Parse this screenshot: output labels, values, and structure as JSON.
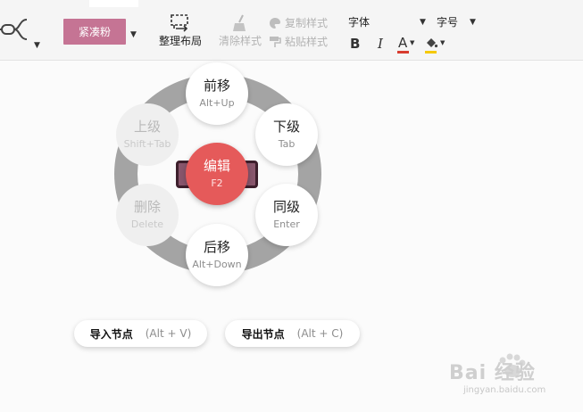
{
  "toolbar": {
    "theme_label": "紧凑粉",
    "layout_label": "整理布局",
    "clear_style_label": "清除样式",
    "copy_style_label": "复制样式",
    "paste_style_label": "粘贴样式",
    "font_label": "字体",
    "font_size_label": "字号",
    "bold_label": "B",
    "italic_label": "I",
    "font_color_label": "A",
    "colors": {
      "theme": "#c57494",
      "font_color_bar": "#d83b2f",
      "bg_color_bar": "#f5c900"
    }
  },
  "hotbox": {
    "center": {
      "label": "编辑",
      "key": "F2"
    },
    "up": {
      "label": "前移",
      "key": "Alt+Up"
    },
    "down": {
      "label": "后移",
      "key": "Alt+Down"
    },
    "child": {
      "label": "下级",
      "key": "Tab"
    },
    "sibling": {
      "label": "同级",
      "key": "Enter"
    },
    "parent": {
      "label": "上级",
      "key": "Shift+Tab"
    },
    "delete": {
      "label": "删除",
      "key": "Delete"
    },
    "colors": {
      "center": "#e55a5a",
      "ring": "#a4a4a4",
      "node": "#88566c"
    }
  },
  "actions": {
    "import": {
      "label": "导入节点",
      "key": "(Alt + V)"
    },
    "export": {
      "label": "导出节点",
      "key": "(Alt + C)"
    }
  },
  "watermark": {
    "text": "Bai 经验",
    "url": "jingyan.baidu.com"
  }
}
